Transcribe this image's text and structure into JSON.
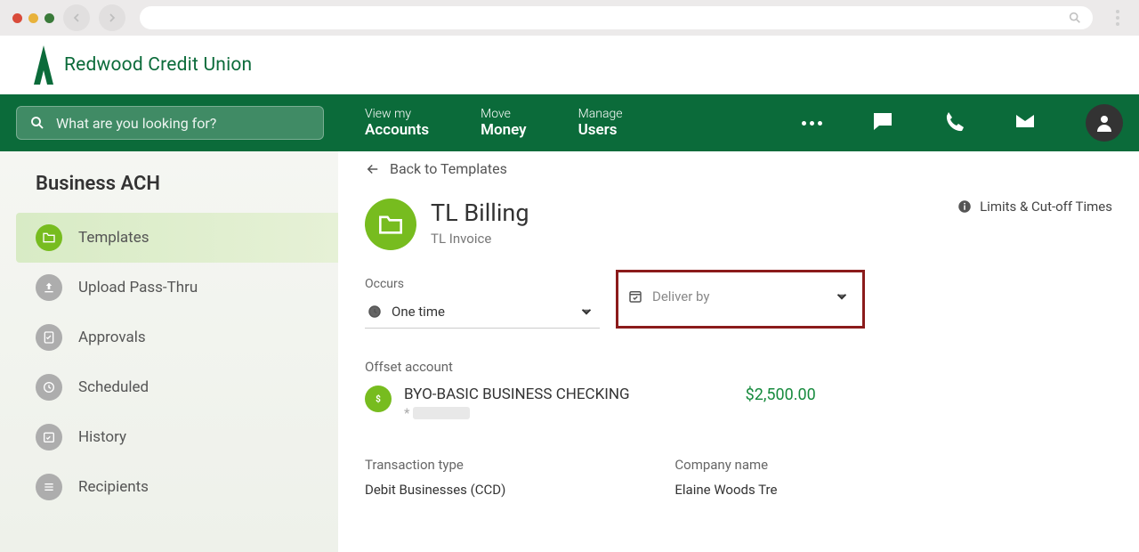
{
  "logo_text": "Redwood Credit Union",
  "search_placeholder": "What are you looking for?",
  "nav": {
    "accounts_top": "View my",
    "accounts_bot": "Accounts",
    "money_top": "Move",
    "money_bot": "Money",
    "users_top": "Manage",
    "users_bot": "Users"
  },
  "sidebar": {
    "title": "Business ACH",
    "items": [
      {
        "label": "Templates"
      },
      {
        "label": "Upload Pass-Thru"
      },
      {
        "label": "Approvals"
      },
      {
        "label": "Scheduled"
      },
      {
        "label": "History"
      },
      {
        "label": "Recipients"
      }
    ]
  },
  "back_label": "Back to Templates",
  "page": {
    "title": "TL Billing",
    "subtitle": "TL Invoice",
    "limits_label": "Limits & Cut-off Times",
    "occurs_label": "Occurs",
    "occurs_value": "One time",
    "deliver_placeholder": "Deliver by",
    "offset_label": "Offset account",
    "offset_name": "BYO-BASIC BUSINESS CHECKING",
    "offset_mask_prefix": "*",
    "offset_amount": "$2,500.00",
    "txn_type_label": "Transaction type",
    "txn_type_val": "Debit Businesses (CCD)",
    "company_label": "Company name",
    "company_val": "Elaine Woods Tre"
  }
}
